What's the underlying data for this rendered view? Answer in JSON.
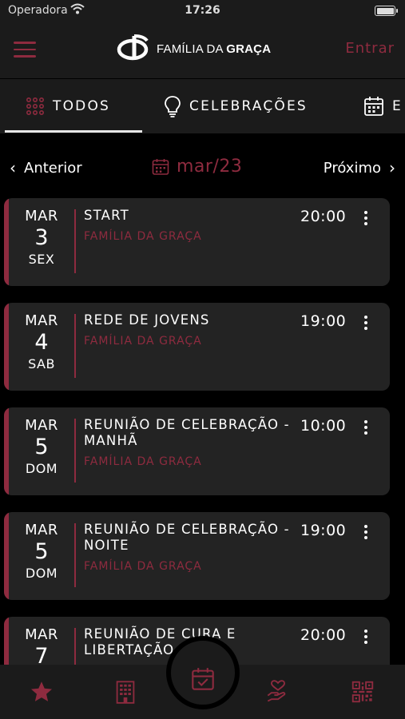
{
  "status_bar": {
    "carrier": "Operadora",
    "time": "17:26"
  },
  "header": {
    "logo_text_light": "FAMÍLIA DA ",
    "logo_text_bold": "GRAÇA",
    "login": "Entrar"
  },
  "tabs": [
    {
      "label": "TODOS",
      "icon": "grid-dots-icon",
      "active": true
    },
    {
      "label": "CELEBRAÇÕES",
      "icon": "lightbulb-icon",
      "active": false
    },
    {
      "label": "E",
      "icon": "calendar-icon",
      "active": false
    }
  ],
  "month_nav": {
    "prev": "Anterior",
    "month": "mar/23",
    "next": "Próximo"
  },
  "events": [
    {
      "month": "MAR",
      "day": "3",
      "weekday": "SEX",
      "title": "START",
      "org": "FAMÍLIA DA GRAÇA",
      "time": "20:00"
    },
    {
      "month": "MAR",
      "day": "4",
      "weekday": "SAB",
      "title": "REDE DE JOVENS",
      "org": "FAMÍLIA DA GRAÇA",
      "time": "19:00"
    },
    {
      "month": "MAR",
      "day": "5",
      "weekday": "DOM",
      "title": "REUNIÃO DE CELEBRAÇÃO - MANHÃ",
      "org": "FAMÍLIA DA GRAÇA",
      "time": "10:00"
    },
    {
      "month": "MAR",
      "day": "5",
      "weekday": "DOM",
      "title": "REUNIÃO DE CELEBRAÇÃO - NOITE",
      "org": "FAMÍLIA DA GRAÇA",
      "time": "19:00"
    },
    {
      "month": "MAR",
      "day": "7",
      "weekday": "",
      "title": "REUNIÃO DE CURA E LIBERTAÇÃO",
      "org": "",
      "time": "20:00"
    }
  ],
  "bottom_nav": [
    {
      "icon": "star-icon",
      "active": true
    },
    {
      "icon": "building-icon",
      "active": false
    },
    {
      "icon": "calendar-check-icon",
      "active": false
    },
    {
      "icon": "hand-heart-icon",
      "active": false
    },
    {
      "icon": "qr-code-icon",
      "active": false
    }
  ],
  "colors": {
    "accent": "#8e2b3f",
    "card": "#232323",
    "bar": "#1b1b1b",
    "background": "#000000"
  }
}
